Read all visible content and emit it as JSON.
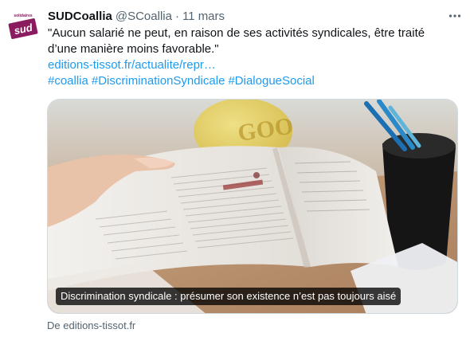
{
  "tweet": {
    "author": {
      "name": "SUDCoallia",
      "handle": "@SCoallia",
      "avatar_text": "sud",
      "avatar_small": "solidaires",
      "avatar_color": "#8a1b5e"
    },
    "separator": "·",
    "date": "11 mars",
    "text_lines": [
      "\"Aucun salarié ne peut, en raison de ses activités syndicales, être traité",
      "d’une manière moins favorable.\""
    ],
    "link": "editions-tissot.fr/actualite/repr…",
    "hashtags": [
      "#coallia",
      "#DiscriminationSyndicale",
      "#DialogueSocial"
    ],
    "card": {
      "caption": "Discrimination syndicale : présumer son existence n’est pas toujours aisé",
      "source": "De editions-tissot.fr"
    },
    "more_icon": "more-horizontal-icon",
    "colors": {
      "link": "#1d9bf0",
      "secondary_text": "#536471",
      "primary_text": "#0f1419"
    }
  }
}
